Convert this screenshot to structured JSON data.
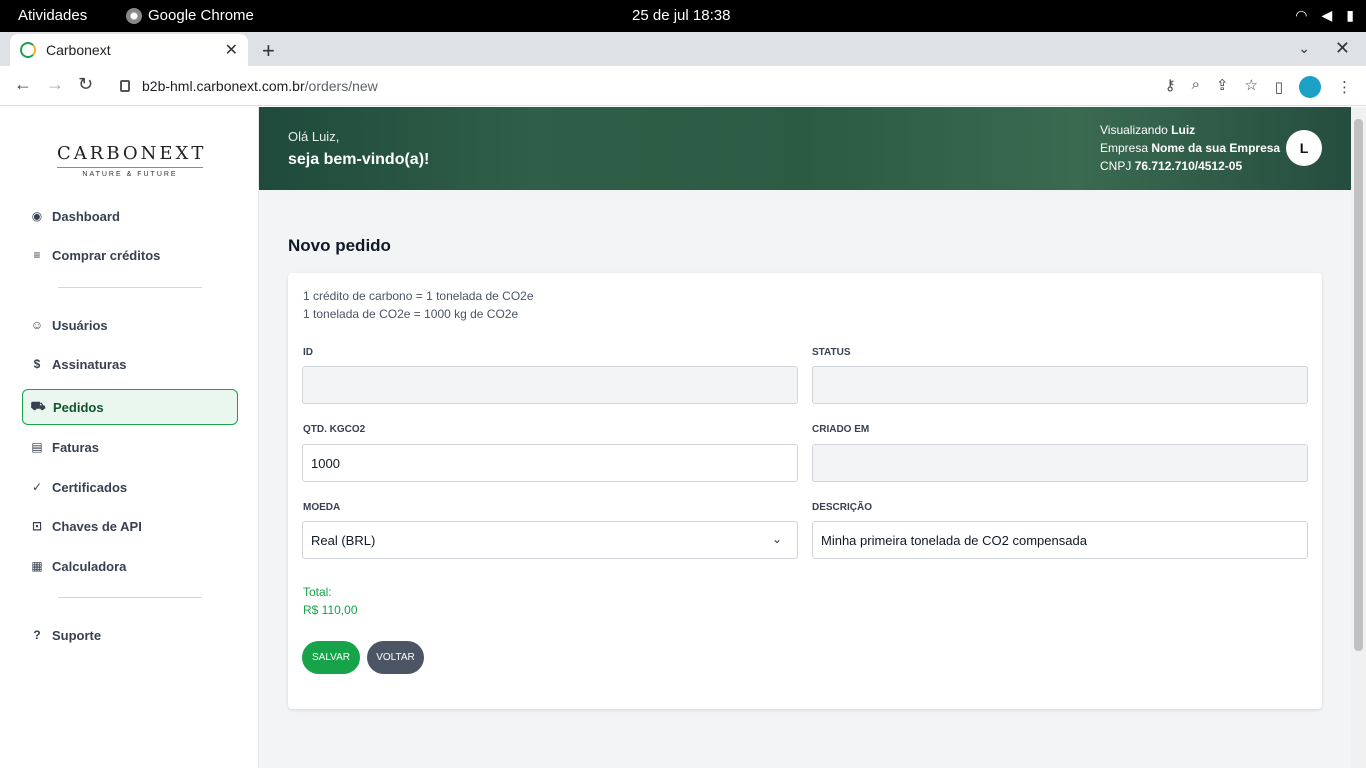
{
  "os": {
    "activities": "Atividades",
    "app_name": "Google Chrome",
    "clock": "25 de jul  18:38"
  },
  "browser": {
    "tab_title": "Carbonext",
    "url_host": "b2b-hml.carbonext.com.br",
    "url_path": "/orders/new"
  },
  "sidebar": {
    "logo_main": "CARBONEXT",
    "logo_sub": "NATURE & FUTURE",
    "items": [
      {
        "label": "Dashboard"
      },
      {
        "label": "Comprar créditos"
      },
      {
        "label": "Usuários"
      },
      {
        "label": "Assinaturas"
      },
      {
        "label": "Pedidos"
      },
      {
        "label": "Faturas"
      },
      {
        "label": "Certificados"
      },
      {
        "label": "Chaves de API"
      },
      {
        "label": "Calculadora"
      },
      {
        "label": "Suporte"
      }
    ]
  },
  "header": {
    "hello": "Olá Luiz,",
    "welcome": "seja bem-vindo(a)!",
    "viewing_label": "Visualizando",
    "viewing_user": "Luiz",
    "company_label": "Empresa",
    "company_name": "Nome da sua Empresa",
    "cnpj_label": "CNPJ",
    "cnpj": "76.712.710/4512-05",
    "avatar_initial": "L"
  },
  "page": {
    "title": "Novo pedido",
    "note_line1": "1 crédito de carbono = 1 tonelada de CO2e",
    "note_line2": "1 tonelada de CO2e = 1000 kg de CO2e"
  },
  "form": {
    "id_label": "ID",
    "id_value": "",
    "status_label": "STATUS",
    "status_value": "",
    "qty_label": "QTD. KGCO2",
    "qty_value": "1000",
    "created_label": "CRIADO EM",
    "created_value": "",
    "currency_label": "MOEDA",
    "currency_value": "Real (BRL)",
    "description_label": "DESCRIÇÃO",
    "description_value": "Minha primeira tonelada de CO2 compensada",
    "total_label": "Total:",
    "total_value": "R$ 110,00",
    "save_label": "SALVAR",
    "back_label": "VOLTAR"
  },
  "colors": {
    "accent": "#16a34a",
    "secondary_button": "#4b5563"
  }
}
